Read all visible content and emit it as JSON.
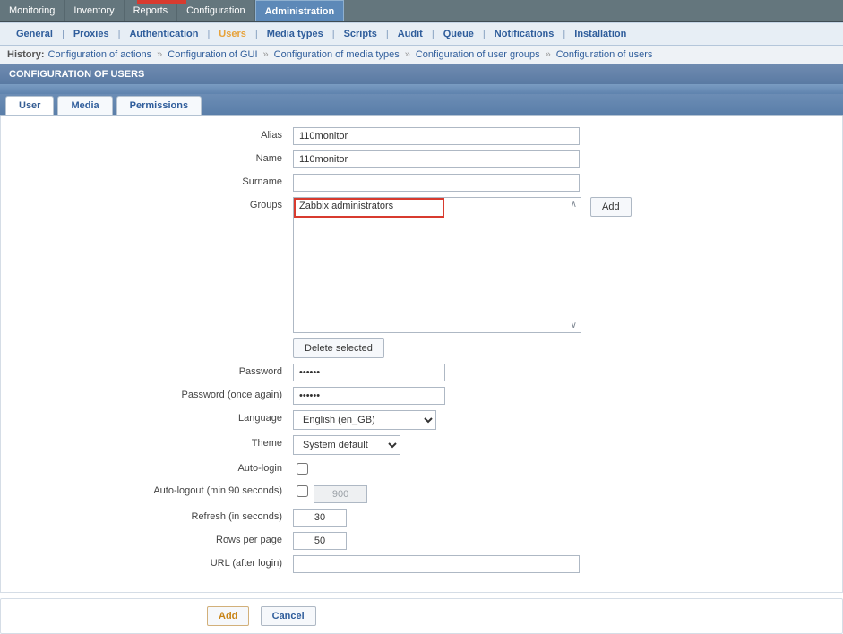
{
  "mainNav": [
    "Monitoring",
    "Inventory",
    "Reports",
    "Configuration",
    "Administration"
  ],
  "mainNavActive": 4,
  "subNav": [
    "General",
    "Proxies",
    "Authentication",
    "Users",
    "Media types",
    "Scripts",
    "Audit",
    "Queue",
    "Notifications",
    "Installation"
  ],
  "subNavCurrent": 3,
  "history": {
    "label": "History:",
    "items": [
      "Configuration of actions",
      "Configuration of GUI",
      "Configuration of media types",
      "Configuration of user groups",
      "Configuration of users"
    ]
  },
  "pageTitle": "Configuration of users",
  "formTabs": [
    "User",
    "Media",
    "Permissions"
  ],
  "formTabActive": 0,
  "labels": {
    "alias": "Alias",
    "name": "Name",
    "surname": "Surname",
    "groups": "Groups",
    "delete": "Delete selected",
    "addgroup": "Add",
    "password": "Password",
    "password2": "Password (once again)",
    "language": "Language",
    "theme": "Theme",
    "autologin": "Auto-login",
    "autologout": "Auto-logout (min 90 seconds)",
    "refresh": "Refresh (in seconds)",
    "rows": "Rows per page",
    "url": "URL (after login)"
  },
  "values": {
    "alias": "110monitor",
    "name": "110monitor",
    "surname": "",
    "group_item": "Zabbix administrators",
    "password": "••••••",
    "password2": "••••••",
    "language": "English (en_GB)",
    "theme": "System default",
    "autologout": "900",
    "refresh": "30",
    "rows": "50",
    "url": ""
  },
  "footer": {
    "add": "Add",
    "cancel": "Cancel"
  }
}
